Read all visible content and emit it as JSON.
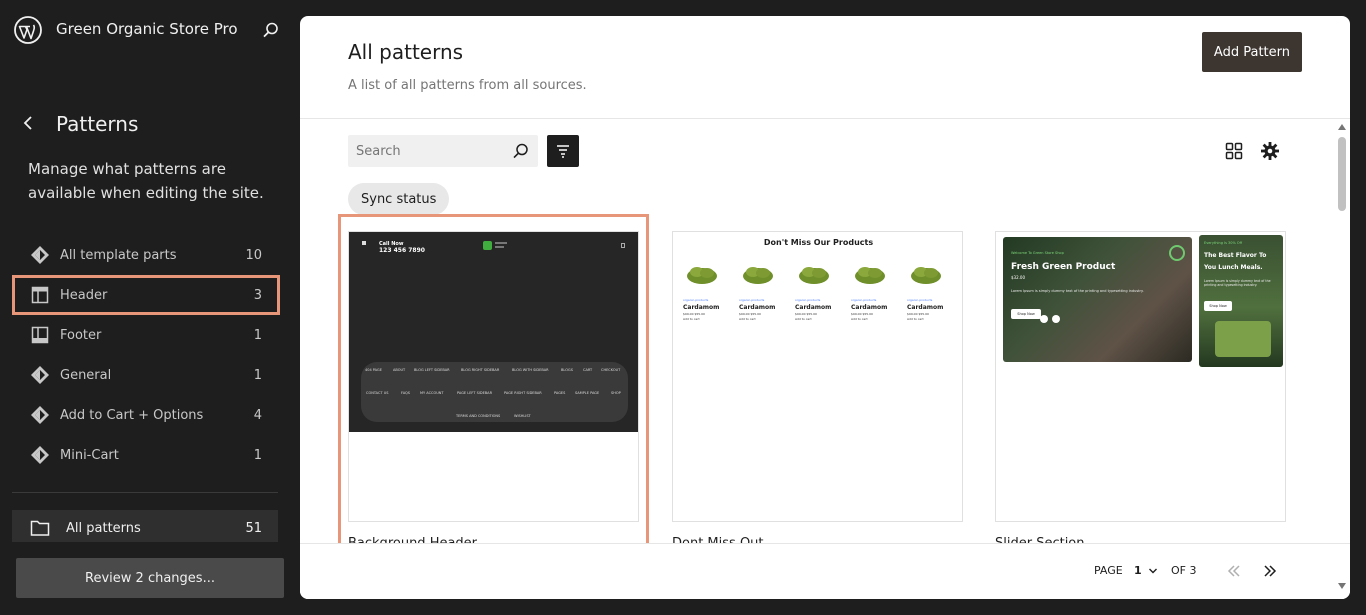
{
  "site": {
    "title": "Green Organic Store Pro"
  },
  "sidebar": {
    "title": "Patterns",
    "description": "Manage what patterns are available when editing the site.",
    "items": [
      {
        "label": "All template parts",
        "count": "10",
        "icon": "diamond-icon"
      },
      {
        "label": "Header",
        "count": "3",
        "icon": "header-layout-icon"
      },
      {
        "label": "Footer",
        "count": "1",
        "icon": "footer-layout-icon"
      },
      {
        "label": "General",
        "count": "1",
        "icon": "diamond-icon"
      },
      {
        "label": "Add to Cart + Options",
        "count": "4",
        "icon": "diamond-icon"
      },
      {
        "label": "Mini-Cart",
        "count": "1",
        "icon": "diamond-icon"
      }
    ],
    "all_patterns": {
      "label": "All patterns",
      "count": "51"
    },
    "review_button": "Review 2 changes..."
  },
  "main": {
    "title": "All patterns",
    "subtitle": "A list of all patterns from all sources.",
    "add_button": "Add Pattern",
    "search": {
      "placeholder": "Search",
      "value": ""
    },
    "chip": "Sync status",
    "cards": [
      {
        "title": "Background Header",
        "preview": {
          "call_now": "Call Now",
          "phone": "123 456 7890",
          "menu_row1": [
            "404 PAGE",
            "ABOUT",
            "BLOG LEFT SIDEBAR",
            "BLOG RIGHT SIDEBAR",
            "BLOG WITH SIDEBAR",
            "BLOGS",
            "CART",
            "CHECKOUT"
          ],
          "menu_row2": [
            "CONTACT US",
            "FAQS",
            "MY ACCOUNT",
            "PAGE LEFT SIDEBAR",
            "PAGE RIGHT SIDEBAR",
            "PAGES",
            "SAMPLE PAGE",
            "SHOP"
          ],
          "menu_row3": [
            "TERMS AND CONDITIONS",
            "WISHLIST"
          ]
        }
      },
      {
        "title": "Dont Miss Out",
        "preview": {
          "heading": "Don't Miss Our Products",
          "product": {
            "category": "organic-products",
            "name": "Cardamom",
            "price": "$99.00 $55.00",
            "add": "Add to cart"
          }
        }
      },
      {
        "title": "Slider Section",
        "preview": {
          "slide1": {
            "welcome": "Welcome To Green Store Shop",
            "headline": "Fresh Green Product",
            "price": "$32.00",
            "text": "Lorem Ipsum is simply dummy text of the printing and typesetting industry.",
            "button": "Shop Now"
          },
          "slide2": {
            "welcome": "Everything Is 30% Off",
            "headline": "The Best Flavor To You Lunch Meals.",
            "text": "Lorem Ipsum is simply dummy text of the printing and typesetting industry.",
            "button": "Shop Now"
          }
        }
      }
    ],
    "pagination": {
      "label": "PAGE",
      "current": "1",
      "of": "OF 3"
    }
  },
  "colors": {
    "accent_outline": "#e8967a",
    "add_button": "#3c3530",
    "sidebar_bg": "#1e1e1e"
  }
}
